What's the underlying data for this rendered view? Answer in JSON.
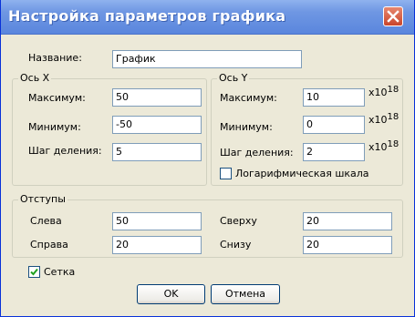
{
  "window": {
    "title": "Настройка параметров графика",
    "close_icon": "close-icon"
  },
  "name_field": {
    "label": "Название:",
    "value": "График"
  },
  "x_axis": {
    "legend": "Ось X",
    "max_label": "Максимум:",
    "max_value": "50",
    "min_label": "Минимум:",
    "min_value": "-50",
    "step_label": "Шаг деления:",
    "step_value": "5"
  },
  "y_axis": {
    "legend": "Ось Y",
    "max_label": "Максимум:",
    "max_value": "10",
    "min_label": "Минимум:",
    "min_value": "0",
    "step_label": "Шаг деления:",
    "step_value": "2",
    "exp_base": "x10",
    "exp_power": "18",
    "log_scale_label": "Логарифмическая шкала",
    "log_scale_checked": false
  },
  "margins": {
    "legend": "Отступы",
    "left_label": "Слева",
    "left_value": "50",
    "right_label": "Справа",
    "right_value": "20",
    "top_label": "Сверху",
    "top_value": "20",
    "bottom_label": "Снизу",
    "bottom_value": "20"
  },
  "grid": {
    "label": "Сетка",
    "checked": true
  },
  "buttons": {
    "ok": "OK",
    "cancel": "Отмена"
  },
  "colors": {
    "titlebar": "#6f97e3",
    "dialog_bg": "#ece9d8",
    "close_button": "#d65a3c"
  }
}
